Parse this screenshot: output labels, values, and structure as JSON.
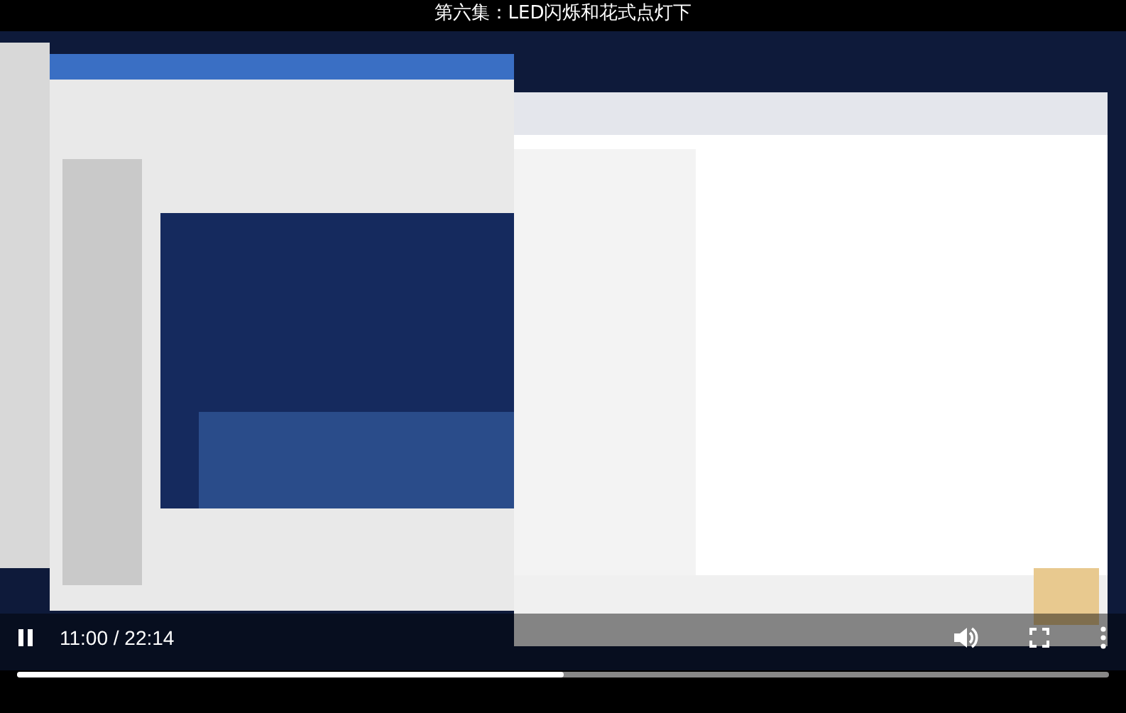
{
  "video": {
    "title": "第六集：LED闪烁和花式点灯下",
    "playing": true,
    "time": "11:00 / 22:14",
    "progress": {
      "level": 0.5
    }
  }
}
